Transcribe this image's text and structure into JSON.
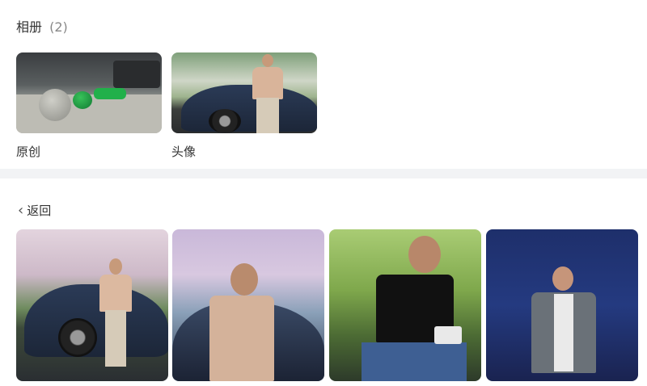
{
  "albums_section": {
    "title": "相册",
    "count": "(2)"
  },
  "albums": [
    {
      "label": "原创"
    },
    {
      "label": "头像"
    }
  ],
  "navigation": {
    "back_label": "返回",
    "back_icon": "chevron-left-icon"
  }
}
